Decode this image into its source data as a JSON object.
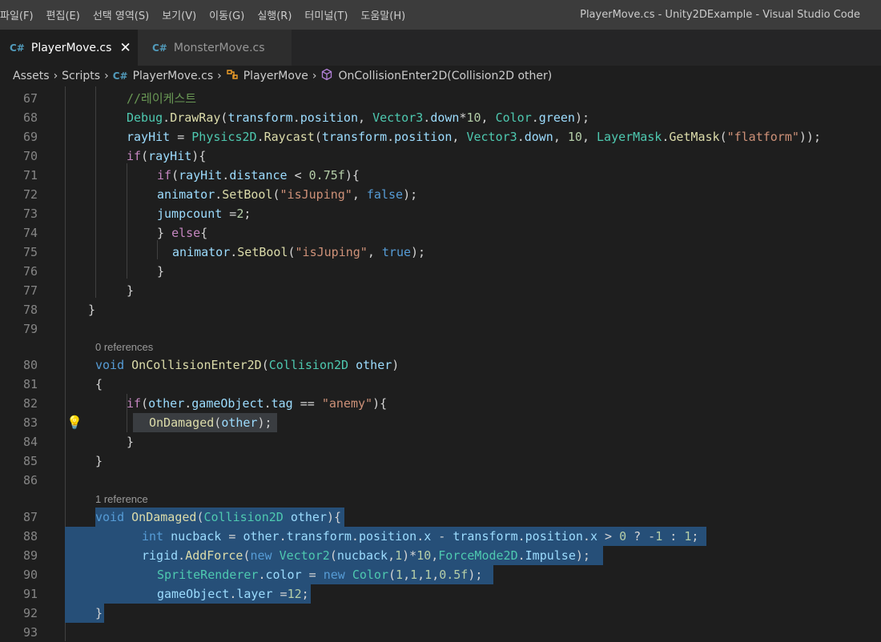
{
  "menu": [
    "파일(F)",
    "편집(E)",
    "선택 영역(S)",
    "보기(V)",
    "이동(G)",
    "실행(R)",
    "터미널(T)",
    "도움말(H)"
  ],
  "window_title": "PlayerMove.cs - Unity2DExample - Visual Studio Code",
  "tabs": [
    {
      "label": "PlayerMove.cs",
      "icon": "csharp-icon",
      "active": true
    },
    {
      "label": "MonsterMove.cs",
      "icon": "csharp-icon",
      "active": false
    }
  ],
  "breadcrumb": [
    "Assets",
    "Scripts",
    "PlayerMove.cs",
    "PlayerMove",
    "OnCollisionEnter2D(Collision2D other)"
  ],
  "line_numbers": [
    "67",
    "68",
    "69",
    "70",
    "71",
    "72",
    "73",
    "74",
    "75",
    "76",
    "77",
    "78",
    "79",
    "80",
    "81",
    "82",
    "83",
    "84",
    "85",
    "86",
    "87",
    "88",
    "89",
    "90",
    "91",
    "92",
    "93"
  ],
  "codelens": [
    "0 references",
    "1 reference"
  ],
  "code": {
    "l67": "//레이케스트",
    "l68": "Debug.DrawRay(transform.position, Vector3.down*10, Color.green);",
    "l69": "rayHit = Physics2D.Raycast(transform.position, Vector3.down, 10, LayerMask.GetMask(\"flatform\"));",
    "l70": "if(rayHit){",
    "l71": "if(rayHit.distance < 0.75f){",
    "l72": "animator.SetBool(\"isJuping\", false);",
    "l73": "jumpcount =2;",
    "l74": "} else{",
    "l75": "animator.SetBool(\"isJuping\", true);",
    "l76": "}",
    "l77": "}",
    "l78": "}",
    "l80": "void OnCollisionEnter2D(Collision2D other)",
    "l81": "{",
    "l82": "if(other.gameObject.tag == \"anemy\"){",
    "l83": "OnDamaged(other);",
    "l84": "}",
    "l85": "}",
    "l87": "void OnDamaged(Collision2D other){",
    "l88": "int nucback = other.transform.position.x - transform.position.x > 0 ? -1 : 1;",
    "l89": "rigid.AddForce(new Vector2(nucback,1)*10,ForceMode2D.Impulse);",
    "l90": "SpriteRenderer.color = new Color(1,1,1,0.5f);",
    "l91": "gameObject.layer =12;",
    "l92": "}"
  }
}
